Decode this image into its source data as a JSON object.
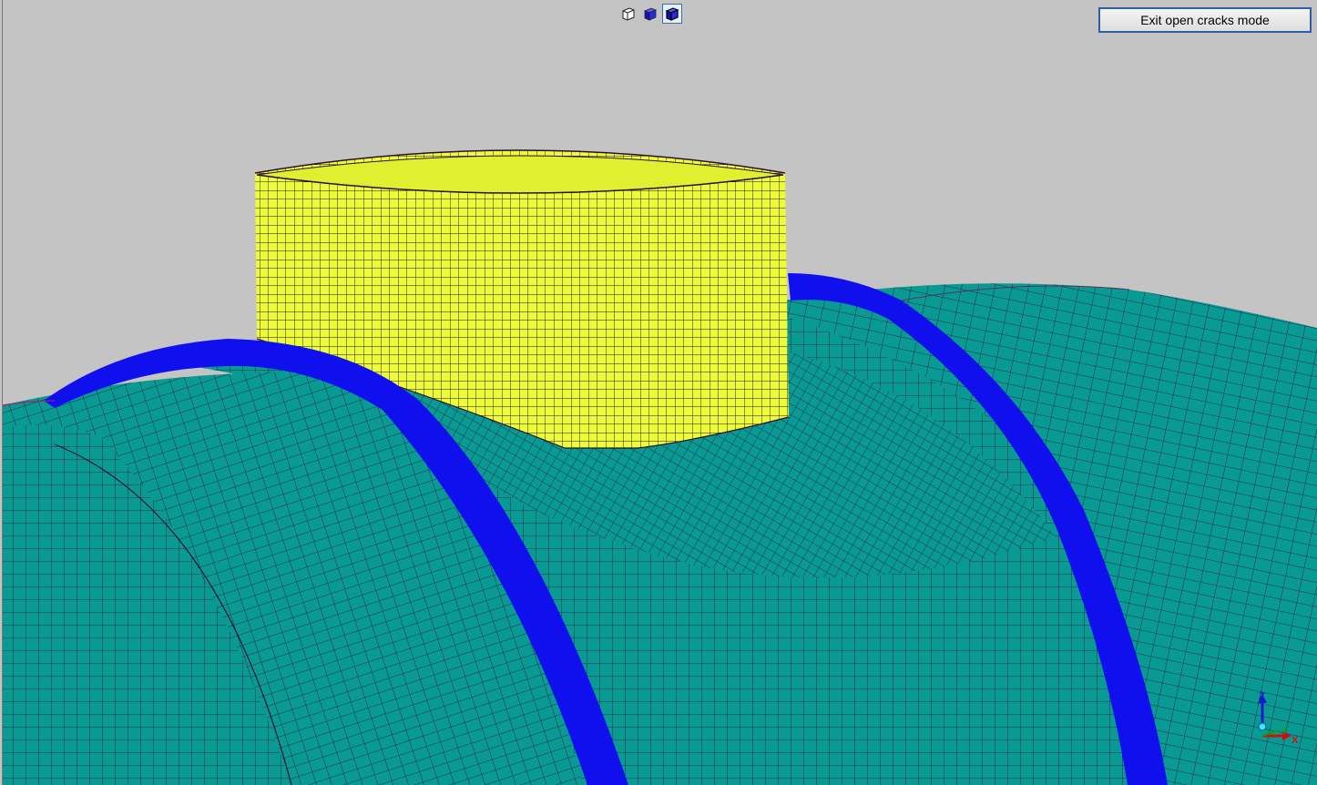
{
  "toolbar": {
    "exit_button_label": "Exit open cracks mode",
    "view_buttons": [
      {
        "name": "wireframe-view",
        "active": false
      },
      {
        "name": "shaded-view",
        "active": false
      },
      {
        "name": "shaded-edges-view",
        "active": true
      }
    ]
  },
  "triad": {
    "z_label": "Z",
    "y_label": "Y",
    "x_label": "X"
  },
  "colors": {
    "background": "#c4c4c4",
    "vessel": "#0a9a94",
    "vessel_dark": "#08807c",
    "ring": "#1010ee",
    "nozzle": "#ecfc3a",
    "mesh_line": "#2a1030",
    "axis_z": "#1a1ad0",
    "axis_y": "#10a010",
    "axis_x": "#d01010"
  }
}
